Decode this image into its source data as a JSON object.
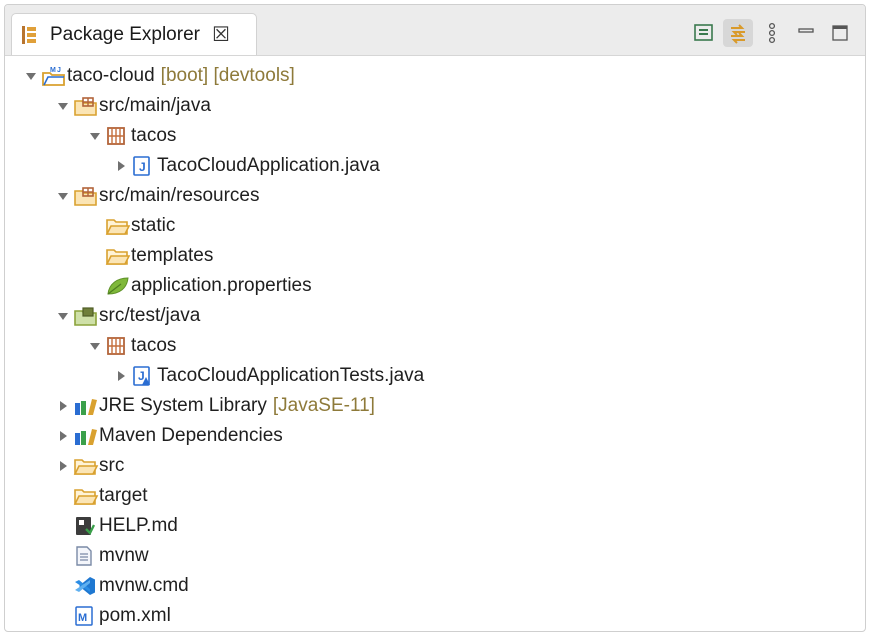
{
  "tab": {
    "title": "Package Explorer",
    "close": "☒"
  },
  "tree": [
    {
      "label": "taco-cloud",
      "decoration": "[boot] [devtools]"
    },
    {
      "label": "src/main/java"
    },
    {
      "label": "tacos"
    },
    {
      "label": "TacoCloudApplication.java"
    },
    {
      "label": "src/main/resources"
    },
    {
      "label": "static"
    },
    {
      "label": "templates"
    },
    {
      "label": "application.properties"
    },
    {
      "label": "src/test/java"
    },
    {
      "label": "tacos"
    },
    {
      "label": "TacoCloudApplicationTests.java"
    },
    {
      "label": "JRE System Library",
      "decoration": "[JavaSE-11]"
    },
    {
      "label": "Maven Dependencies"
    },
    {
      "label": "src"
    },
    {
      "label": "target"
    },
    {
      "label": "HELP.md"
    },
    {
      "label": "mvnw"
    },
    {
      "label": "mvnw.cmd"
    },
    {
      "label": "pom.xml"
    }
  ],
  "icons": {
    "project": "maven-project-icon",
    "source_folder": "source-folder-icon",
    "package": "package-icon",
    "java_file": "java-file-icon",
    "folder": "folder-icon",
    "spring_properties": "spring-leaf-icon",
    "library": "library-icon",
    "markdown": "markdown-file-icon",
    "text_file": "text-file-icon",
    "cmd_file": "vscode-file-icon",
    "maven_pom": "maven-pom-icon"
  },
  "colors": {
    "decoration": "#8e7a3a",
    "folder": "#e2a734",
    "package": "#b2643a",
    "java_blue": "#2a6dd2"
  }
}
